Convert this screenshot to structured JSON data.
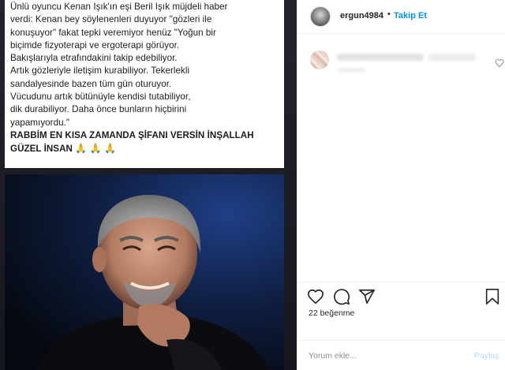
{
  "post": {
    "caption_lines": [
      "Ünlü oyuncu Kenan Işık'ın eşi Beril Işık müjdeli haber",
      "verdi: Kenan bey söylenenleri duyuyor \"gözleri ile",
      "konuşuyor\" fakat tepki veremiyor henüz \"Yoğun bir",
      "biçimde fizyoterapi ve ergoterapi görüyor.",
      "Bakışlarıyla etrafındakini takip edebiliyor.",
      "Artık gözleriyle iletişim kurabiliyor. Tekerlekli",
      "sandalyesinde bazen tüm gün oturuyor.",
      "Vücudunu artık bütünüyle kendisi tutabiliyor,",
      "dik durabiliyor. Daha önce bunların hiçbirini",
      "yapamıyordu.\""
    ],
    "caption_bold_lines": [
      "RABBİM EN KISA ZAMANDA ŞİFANI VERSİN İNŞALLAH",
      "GÜZEL İNSAN"
    ],
    "emoji": "🙏 🙏 🙏"
  },
  "header": {
    "username": "ergun4984",
    "separator": "•",
    "follow_label": "Takip Et"
  },
  "actions": {
    "like_icon": "heart-icon",
    "comment_icon": "comment-icon",
    "share_icon": "share-icon",
    "save_icon": "bookmark-icon"
  },
  "likes_text": "22 beğenme",
  "add_comment": {
    "placeholder": "Yorum ekle...",
    "share_label": "Paylaş"
  },
  "colors": {
    "accent": "#0095f6",
    "share_disabled": "#b2dffc"
  }
}
